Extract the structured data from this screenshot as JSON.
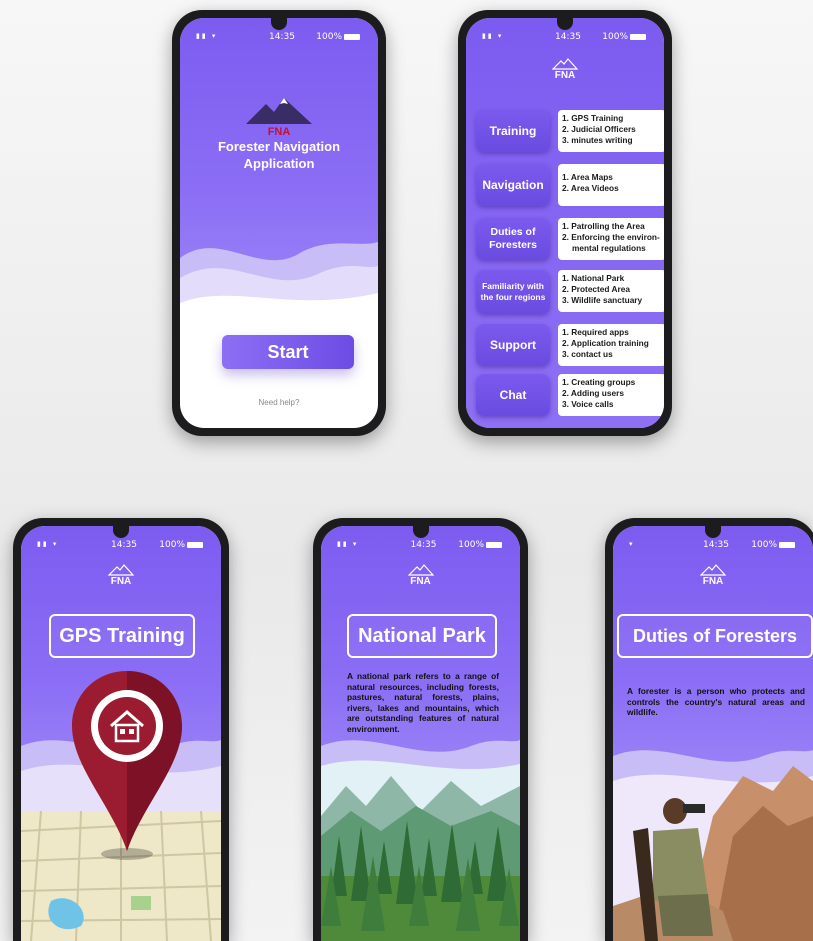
{
  "status": {
    "time": "14:35",
    "battery": "100%"
  },
  "brand": {
    "logo": "FNA",
    "title_line1": "Forester Navigation",
    "title_line2": "Application"
  },
  "welcome": {
    "start": "Start",
    "help": "Need help?"
  },
  "menu": [
    {
      "label": "Training",
      "items": [
        "1. GPS Training",
        "2. Judicial Officers",
        "3. minutes writing"
      ]
    },
    {
      "label": "Navigation",
      "items": [
        "1. Area Maps",
        "2. Area Videos"
      ]
    },
    {
      "label": "Duties of Foresters",
      "items": [
        "1. Patrolling the Area",
        "2. Enforcing the environ-",
        "mental regulations"
      ]
    },
    {
      "label": "Familiarity with the four regions",
      "items": [
        "1. National Park",
        "2. Protected Area",
        "3. Wildlife sanctuary"
      ]
    },
    {
      "label": "Support",
      "items": [
        "1. Required apps",
        "2. Application training",
        "3. contact us"
      ]
    },
    {
      "label": "Chat",
      "items": [
        "1. Creating groups",
        "2. Adding users",
        "3. Voice calls"
      ]
    }
  ],
  "gps": {
    "title": "GPS Training"
  },
  "park": {
    "title": "National Park",
    "text": "A national park refers to a range of natural resources, including forests, pastures, natural forests, plains, rivers, lakes and mountains, which are outstanding features of natural environment."
  },
  "duties": {
    "title": "Duties of Foresters",
    "text": "A forester is a person who protects and controls the country's natural areas and wildlife."
  },
  "colors": {
    "primary": "#7c5cf0",
    "accent": "#c8102e",
    "pin": "#9b1b30"
  },
  "icons": [
    "signal-icon",
    "wifi-icon",
    "battery-icon",
    "mountain-logo-icon",
    "location-pin-icon",
    "house-icon"
  ]
}
